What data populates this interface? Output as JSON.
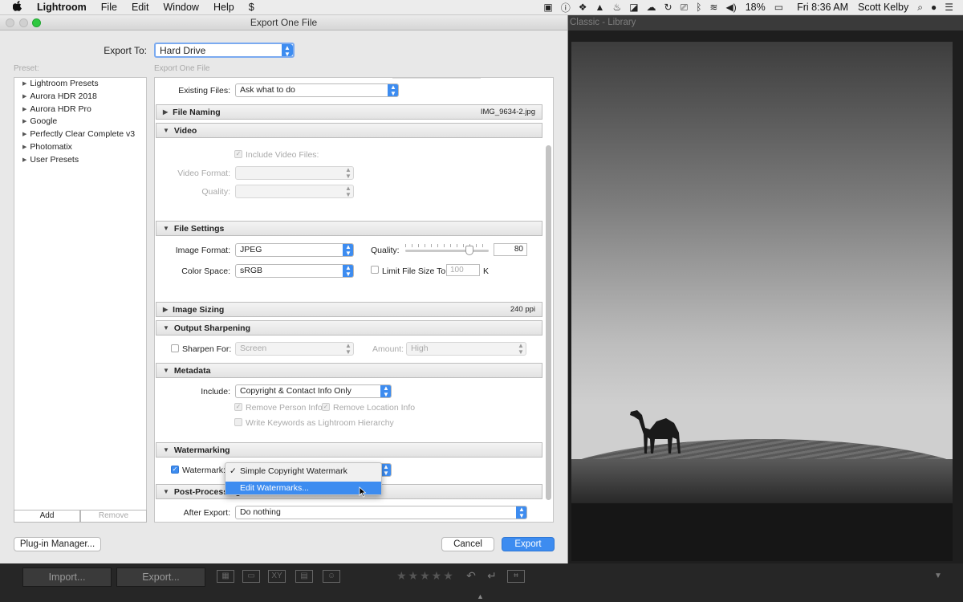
{
  "menubar": {
    "apple": "",
    "app": "Lightroom",
    "items": [
      "File",
      "Edit",
      "Window",
      "Help"
    ],
    "battery": "18%",
    "clock": "Fri 8:36 AM",
    "user": "Scott Kelby"
  },
  "lr": {
    "window_title": "Classic - Library",
    "import_label": "Import...",
    "export_label": "Export...",
    "stars": "★★★★★"
  },
  "dialog": {
    "title": "Export One File",
    "export_to_label": "Export To:",
    "export_to_value": "Hard Drive",
    "preset_label": "Preset:",
    "panel_label": "Export One File",
    "presets": [
      "Lightroom Presets",
      "Aurora HDR 2018",
      "Aurora HDR Pro",
      "Google",
      "Perfectly Clear Complete v3",
      "Photomatix",
      "User Presets"
    ],
    "add_label": "Add",
    "remove_label": "Remove",
    "existing_files_label": "Existing Files:",
    "existing_files_value": "Ask what to do",
    "file_naming": {
      "title": "File Naming",
      "value": "IMG_9634-2.jpg"
    },
    "video": {
      "title": "Video",
      "include": "Include Video Files:",
      "format_label": "Video Format:",
      "quality_label": "Quality:"
    },
    "file_settings": {
      "title": "File Settings",
      "image_format_label": "Image Format:",
      "image_format": "JPEG",
      "quality_label": "Quality:",
      "quality": "80",
      "color_space_label": "Color Space:",
      "color_space": "sRGB",
      "limit_label": "Limit File Size To:",
      "limit_value": "100",
      "limit_unit": "K"
    },
    "image_sizing": {
      "title": "Image Sizing",
      "value": "240 ppi"
    },
    "sharpening": {
      "title": "Output Sharpening",
      "sharpen_label": "Sharpen For:",
      "sharpen_value": "Screen",
      "amount_label": "Amount:",
      "amount_value": "High"
    },
    "metadata": {
      "title": "Metadata",
      "include_label": "Include:",
      "include_value": "Copyright & Contact Info Only",
      "remove_person": "Remove Person Info",
      "remove_location": "Remove Location Info",
      "write_keywords": "Write Keywords as Lightroom Hierarchy"
    },
    "watermarking": {
      "title": "Watermarking",
      "label": "Watermark:",
      "menu_items": [
        "Simple Copyright Watermark",
        "Edit Watermarks..."
      ]
    },
    "post": {
      "title": "Post-Processing",
      "after_label": "After Export:",
      "after_value": "Do nothing"
    },
    "plugin_label": "Plug-in Manager...",
    "cancel_label": "Cancel",
    "export_label": "Export"
  }
}
